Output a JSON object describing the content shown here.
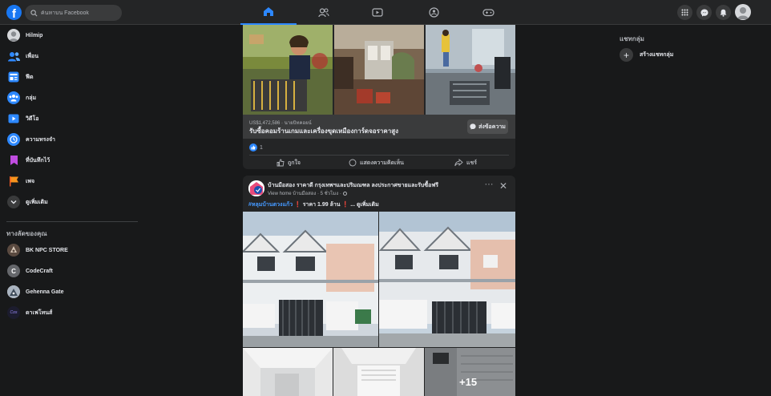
{
  "topbar": {
    "logo": "f",
    "search_placeholder": "ค้นหาบน Facebook",
    "nav_icons": [
      "home-icon",
      "friends-icon",
      "watch-icon",
      "groups-icon",
      "gaming-icon"
    ],
    "right_icons": [
      "menu-grid-icon",
      "messenger-icon",
      "notifications-bell-icon",
      "profile-avatar"
    ]
  },
  "sidebar": {
    "items": [
      {
        "label": "Hilmip",
        "icon": "profile-avatar"
      },
      {
        "label": "เพื่อน",
        "icon": "friends-icon"
      },
      {
        "label": "ฟีด",
        "icon": "feed-icon"
      },
      {
        "label": "กลุ่ม",
        "icon": "groups-icon"
      },
      {
        "label": "วิดีโอ",
        "icon": "video-icon"
      },
      {
        "label": "ความทรงจำ",
        "icon": "memories-clock-icon"
      },
      {
        "label": "ที่บันทึกไว้",
        "icon": "bookmark-icon"
      },
      {
        "label": "เพจ",
        "icon": "flag-icon"
      },
      {
        "label": "ดูเพิ่มเติม",
        "icon": "chevron-down-icon"
      }
    ],
    "shortcuts_header": "ทางลัดของคุณ",
    "shortcuts": [
      {
        "label": "BK NPC STORE",
        "initial": ""
      },
      {
        "label": "CodeCraft",
        "initial": "C"
      },
      {
        "label": "Gehenna Gate",
        "initial": ""
      },
      {
        "label": "ดาเฟโทนส์",
        "initial": "Cos"
      }
    ]
  },
  "ad_post": {
    "subtitle": "US$1,472,586 · นายบิทคอยน์",
    "title": "รับซื้อคอมร้านเกมและเครื่องขุดเหมืองการ์ดจอราคาสูง",
    "message_button": "ส่งข้อความ",
    "reaction_count": "1",
    "actions": {
      "like": "ถูกใจ",
      "comment": "แสดงความคิดเห็น",
      "share": "แชร์"
    }
  },
  "house_post": {
    "page_name": "บ้านมือสอง ราคาดี กรุงเทพฯและปริมณฑล ลงประกาศขายและรับซื้อฟรี",
    "meta": "View home บ้านมือสอง · 5 ชั่วโมง ·",
    "hashtag": "#หลุมบ้านตวงแก้ว",
    "price_text": " ❗ ราคา 1.99 ล้าน ❗ ...",
    "see_more": " ดูเพิ่มเติม",
    "more_photos": "+15"
  },
  "right": {
    "header": "แชทกลุ่ม",
    "create_group": "สร้างแชทกลุ่ม"
  },
  "colors": {
    "background": "#18191a",
    "surface": "#242526",
    "accent": "#2d88ff"
  }
}
